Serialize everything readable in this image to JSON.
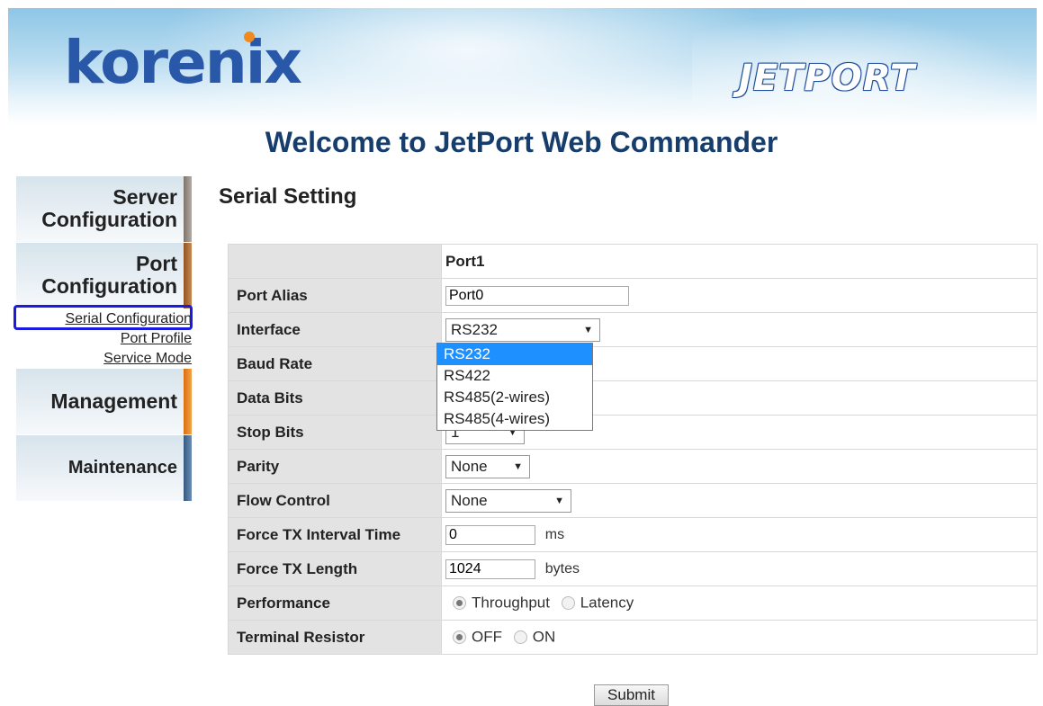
{
  "header": {
    "brand": "korenix",
    "product": "JETPORT",
    "welcome": "Welcome to JetPort Web Commander"
  },
  "sidebar": {
    "server_line1": "Server",
    "server_line2": "Configuration",
    "port_line1": "Port",
    "port_line2": "Configuration",
    "sub_items": [
      "Serial Configuration",
      "Port Profile",
      "Service Mode"
    ],
    "management": "Management",
    "maintenance": "Maintenance",
    "edge_colors": {
      "server": "#9a8f86",
      "port": "#b5733a",
      "management": "#ee8a22",
      "maintenance": "#4a6e95"
    }
  },
  "main": {
    "title": "Serial Setting",
    "column_header": "Port1",
    "rows": {
      "port_alias": {
        "label": "Port Alias",
        "value": "Port0"
      },
      "interface": {
        "label": "Interface",
        "value": "RS232"
      },
      "baud_rate": {
        "label": "Baud Rate"
      },
      "data_bits": {
        "label": "Data Bits"
      },
      "stop_bits": {
        "label": "Stop Bits",
        "value": "1"
      },
      "parity": {
        "label": "Parity",
        "value": "None"
      },
      "flow_control": {
        "label": "Flow Control",
        "value": "None"
      },
      "force_tx_interval": {
        "label": "Force TX Interval Time",
        "value": "0",
        "unit": "ms"
      },
      "force_tx_length": {
        "label": "Force TX Length",
        "value": "1024",
        "unit": "bytes"
      },
      "performance": {
        "label": "Performance",
        "options": [
          "Throughput",
          "Latency"
        ],
        "selected": "Throughput"
      },
      "terminal_resistor": {
        "label": "Terminal Resistor",
        "options": [
          "OFF",
          "ON"
        ],
        "selected": "OFF"
      }
    },
    "interface_dropdown": {
      "options": [
        "RS232",
        "RS422",
        "RS485(2-wires)",
        "RS485(4-wires)"
      ],
      "highlighted": "RS232"
    },
    "submit_label": "Submit"
  },
  "colors": {
    "highlight_box": "#1a1ae0",
    "dropdown_selected": "#1e90ff",
    "welcome_text": "#163d6b",
    "brand_blue": "#2a58a8",
    "brand_dot": "#f08a1c"
  }
}
